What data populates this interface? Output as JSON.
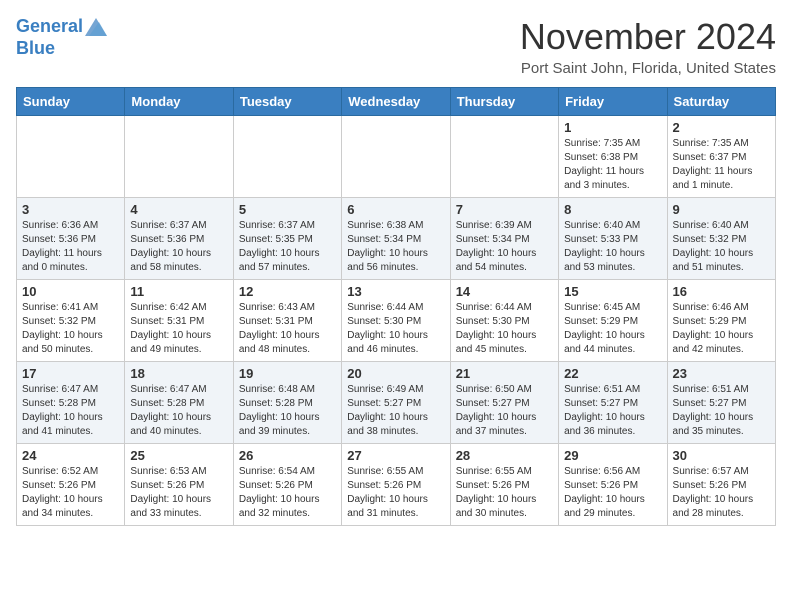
{
  "header": {
    "logo": {
      "line1": "General",
      "line2": "Blue"
    },
    "title": "November 2024",
    "location": "Port Saint John, Florida, United States"
  },
  "weekdays": [
    "Sunday",
    "Monday",
    "Tuesday",
    "Wednesday",
    "Thursday",
    "Friday",
    "Saturday"
  ],
  "weeks": [
    [
      {
        "day": null,
        "info": null
      },
      {
        "day": null,
        "info": null
      },
      {
        "day": null,
        "info": null
      },
      {
        "day": null,
        "info": null
      },
      {
        "day": null,
        "info": null
      },
      {
        "day": "1",
        "info": "Sunrise: 7:35 AM\nSunset: 6:38 PM\nDaylight: 11 hours\nand 3 minutes."
      },
      {
        "day": "2",
        "info": "Sunrise: 7:35 AM\nSunset: 6:37 PM\nDaylight: 11 hours\nand 1 minute."
      }
    ],
    [
      {
        "day": "3",
        "info": "Sunrise: 6:36 AM\nSunset: 5:36 PM\nDaylight: 11 hours\nand 0 minutes."
      },
      {
        "day": "4",
        "info": "Sunrise: 6:37 AM\nSunset: 5:36 PM\nDaylight: 10 hours\nand 58 minutes."
      },
      {
        "day": "5",
        "info": "Sunrise: 6:37 AM\nSunset: 5:35 PM\nDaylight: 10 hours\nand 57 minutes."
      },
      {
        "day": "6",
        "info": "Sunrise: 6:38 AM\nSunset: 5:34 PM\nDaylight: 10 hours\nand 56 minutes."
      },
      {
        "day": "7",
        "info": "Sunrise: 6:39 AM\nSunset: 5:34 PM\nDaylight: 10 hours\nand 54 minutes."
      },
      {
        "day": "8",
        "info": "Sunrise: 6:40 AM\nSunset: 5:33 PM\nDaylight: 10 hours\nand 53 minutes."
      },
      {
        "day": "9",
        "info": "Sunrise: 6:40 AM\nSunset: 5:32 PM\nDaylight: 10 hours\nand 51 minutes."
      }
    ],
    [
      {
        "day": "10",
        "info": "Sunrise: 6:41 AM\nSunset: 5:32 PM\nDaylight: 10 hours\nand 50 minutes."
      },
      {
        "day": "11",
        "info": "Sunrise: 6:42 AM\nSunset: 5:31 PM\nDaylight: 10 hours\nand 49 minutes."
      },
      {
        "day": "12",
        "info": "Sunrise: 6:43 AM\nSunset: 5:31 PM\nDaylight: 10 hours\nand 48 minutes."
      },
      {
        "day": "13",
        "info": "Sunrise: 6:44 AM\nSunset: 5:30 PM\nDaylight: 10 hours\nand 46 minutes."
      },
      {
        "day": "14",
        "info": "Sunrise: 6:44 AM\nSunset: 5:30 PM\nDaylight: 10 hours\nand 45 minutes."
      },
      {
        "day": "15",
        "info": "Sunrise: 6:45 AM\nSunset: 5:29 PM\nDaylight: 10 hours\nand 44 minutes."
      },
      {
        "day": "16",
        "info": "Sunrise: 6:46 AM\nSunset: 5:29 PM\nDaylight: 10 hours\nand 42 minutes."
      }
    ],
    [
      {
        "day": "17",
        "info": "Sunrise: 6:47 AM\nSunset: 5:28 PM\nDaylight: 10 hours\nand 41 minutes."
      },
      {
        "day": "18",
        "info": "Sunrise: 6:47 AM\nSunset: 5:28 PM\nDaylight: 10 hours\nand 40 minutes."
      },
      {
        "day": "19",
        "info": "Sunrise: 6:48 AM\nSunset: 5:28 PM\nDaylight: 10 hours\nand 39 minutes."
      },
      {
        "day": "20",
        "info": "Sunrise: 6:49 AM\nSunset: 5:27 PM\nDaylight: 10 hours\nand 38 minutes."
      },
      {
        "day": "21",
        "info": "Sunrise: 6:50 AM\nSunset: 5:27 PM\nDaylight: 10 hours\nand 37 minutes."
      },
      {
        "day": "22",
        "info": "Sunrise: 6:51 AM\nSunset: 5:27 PM\nDaylight: 10 hours\nand 36 minutes."
      },
      {
        "day": "23",
        "info": "Sunrise: 6:51 AM\nSunset: 5:27 PM\nDaylight: 10 hours\nand 35 minutes."
      }
    ],
    [
      {
        "day": "24",
        "info": "Sunrise: 6:52 AM\nSunset: 5:26 PM\nDaylight: 10 hours\nand 34 minutes."
      },
      {
        "day": "25",
        "info": "Sunrise: 6:53 AM\nSunset: 5:26 PM\nDaylight: 10 hours\nand 33 minutes."
      },
      {
        "day": "26",
        "info": "Sunrise: 6:54 AM\nSunset: 5:26 PM\nDaylight: 10 hours\nand 32 minutes."
      },
      {
        "day": "27",
        "info": "Sunrise: 6:55 AM\nSunset: 5:26 PM\nDaylight: 10 hours\nand 31 minutes."
      },
      {
        "day": "28",
        "info": "Sunrise: 6:55 AM\nSunset: 5:26 PM\nDaylight: 10 hours\nand 30 minutes."
      },
      {
        "day": "29",
        "info": "Sunrise: 6:56 AM\nSunset: 5:26 PM\nDaylight: 10 hours\nand 29 minutes."
      },
      {
        "day": "30",
        "info": "Sunrise: 6:57 AM\nSunset: 5:26 PM\nDaylight: 10 hours\nand 28 minutes."
      }
    ]
  ]
}
